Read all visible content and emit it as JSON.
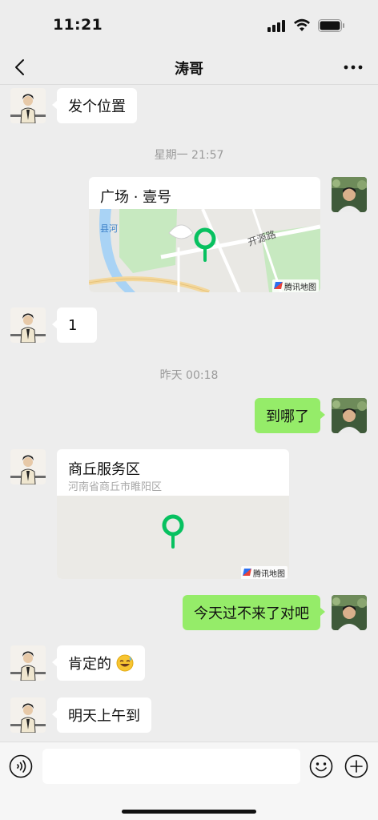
{
  "status_bar": {
    "time": "11:21"
  },
  "nav": {
    "title": "涛哥"
  },
  "messages": {
    "m1": {
      "text": "发个位置"
    },
    "ts1": {
      "text": "星期一 21:57"
    },
    "loc1": {
      "title": "广场 · 壹号",
      "road_label": "开源路",
      "river_label": "县河",
      "credit": "腾讯地图"
    },
    "m2": {
      "text": "1"
    },
    "ts2": {
      "text": "昨天 00:18"
    },
    "m3": {
      "text": "到哪了"
    },
    "loc2": {
      "title": "商丘服务区",
      "address": "河南省商丘市睢阳区",
      "credit": "腾讯地图"
    },
    "m4": {
      "text": "今天过不来了对吧"
    },
    "m5": {
      "text": "肯定的",
      "emoji": "grinning-sweat-emoji"
    },
    "m6": {
      "text": "明天上午到"
    }
  },
  "input": {
    "placeholder": ""
  },
  "colors": {
    "background": "#ededed",
    "outgoing_bubble": "#95ec69",
    "incoming_bubble": "#ffffff",
    "map_pin": "#07c160"
  },
  "icons": {
    "back": "back-chevron-icon",
    "more": "more-dots-icon",
    "voice": "voice-icon",
    "emoji": "emoji-face-icon",
    "plus": "plus-icon"
  }
}
